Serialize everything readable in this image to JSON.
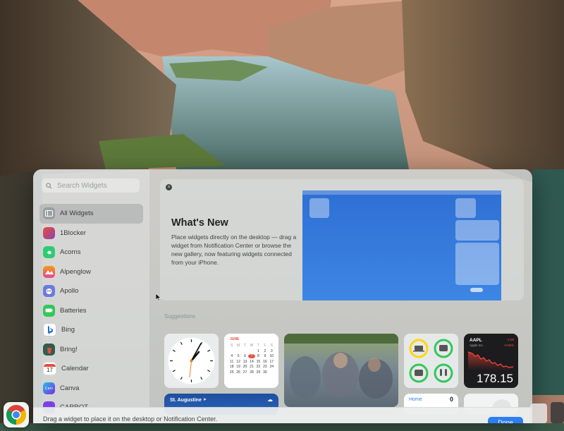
{
  "search": {
    "placeholder": "Search Widgets"
  },
  "sidebar": {
    "items": [
      {
        "label": "All Widgets",
        "icon": "all-widgets-icon",
        "color": "#8a8f8f"
      },
      {
        "label": "1Blocker",
        "icon": "1blocker-icon",
        "color": "#c0392b"
      },
      {
        "label": "Acorns",
        "icon": "acorns-icon",
        "color": "#27ae60"
      },
      {
        "label": "Alpenglow",
        "icon": "alpenglow-icon",
        "color": "#e67e22"
      },
      {
        "label": "Apollo",
        "icon": "apollo-icon",
        "color": "#5b6ee1"
      },
      {
        "label": "Batteries",
        "icon": "batteries-icon",
        "color": "#34c759"
      },
      {
        "label": "Bing",
        "icon": "bing-icon",
        "color": "#1f6fd1"
      },
      {
        "label": "Bring!",
        "icon": "bring-icon",
        "color": "#2f5d50"
      },
      {
        "label": "Calendar",
        "icon": "calendar-icon",
        "color": "#e74c3c"
      },
      {
        "label": "Canva",
        "icon": "canva-icon",
        "color": "#1ab7d6"
      },
      {
        "label": "CARROT",
        "icon": "carrot-icon",
        "color": "#7b3fe4"
      }
    ]
  },
  "hero": {
    "title": "What's New",
    "body": "Place widgets directly on the desktop — drag a widget from Notification Center or browse the new gallery, now featuring widgets connected from your iPhone."
  },
  "suggestions": {
    "label": "Suggestions"
  },
  "calendar_widget": {
    "month": "JUNE",
    "weekdays": [
      "S",
      "M",
      "T",
      "W",
      "T",
      "F",
      "S"
    ],
    "days": [
      "",
      "",
      "",
      "",
      "1",
      "2",
      "3",
      "4",
      "5",
      "6",
      "7",
      "8",
      "9",
      "10",
      "11",
      "12",
      "13",
      "14",
      "15",
      "16",
      "17",
      "18",
      "19",
      "20",
      "21",
      "22",
      "23",
      "24",
      "25",
      "26",
      "27",
      "28",
      "29",
      "30"
    ],
    "today": "7"
  },
  "stocks_widget": {
    "ticker": "AAPL",
    "company": "Apple Inc.",
    "change": "-1.09",
    "percent": "-0.65%",
    "price": "178.15"
  },
  "weather_widget": {
    "city": "St. Augustine"
  },
  "home_widget": {
    "label": "Home",
    "count": "0"
  },
  "footer": {
    "hint": "Drag a widget to place it on the desktop or Notification Center.",
    "done_label": "Done"
  },
  "colors": {
    "accent": "#2c7ef3",
    "preview_blue": "#3478e0",
    "stocks_red": "#ff453a",
    "battery_green": "#34c759",
    "battery_yellow": "#ffd60a"
  }
}
